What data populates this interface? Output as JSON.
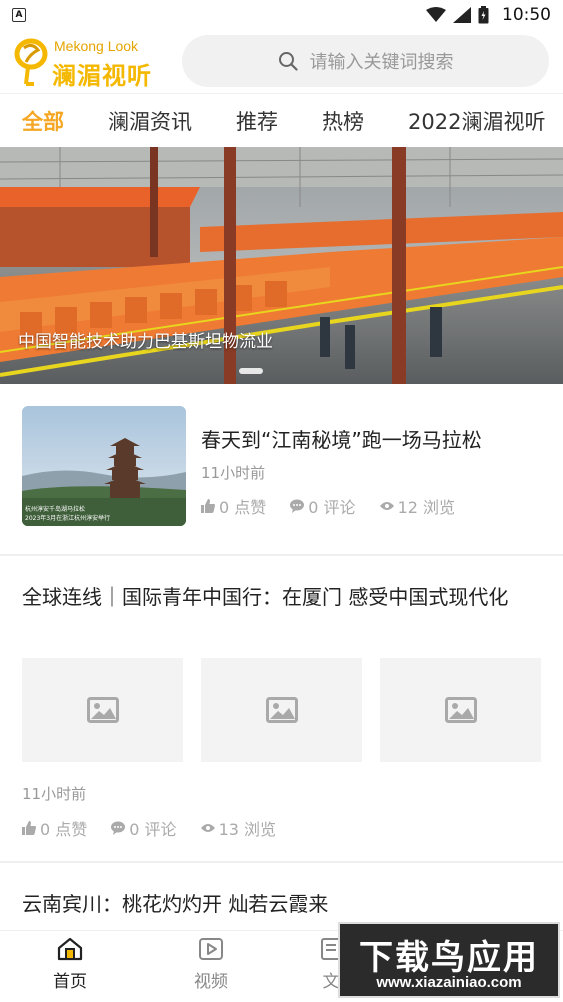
{
  "status_bar": {
    "time": "10:50",
    "left_icon_letter": "A"
  },
  "header": {
    "logo_en": "Mekong Look",
    "logo_cn": "澜湄视听",
    "search_placeholder": "请输入关键词搜索",
    "accent_color": "#f5a623"
  },
  "tabs": [
    {
      "label": "全部",
      "active": true
    },
    {
      "label": "澜湄资讯",
      "active": false
    },
    {
      "label": "推荐",
      "active": false
    },
    {
      "label": "热榜",
      "active": false
    },
    {
      "label": "2022澜湄视听",
      "active": false
    }
  ],
  "banner": {
    "caption": "中国智能技术助力巴基斯坦物流业"
  },
  "news": [
    {
      "title": "春天到“江南秘境”跑一场马拉松",
      "time": "11小时前",
      "likes": "0 点赞",
      "comments": "0 评论",
      "views": "12 浏览",
      "thumb_caption_1": "杭州淳安千岛湖马拉松",
      "thumb_caption_2": "2023年3月在浙江杭州淳安举行"
    },
    {
      "title": "全球连线｜国际青年中国行：在厦门 感受中国式现代化",
      "time": "11小时前",
      "likes": "0 点赞",
      "comments": "0 评论",
      "views": "13 浏览"
    },
    {
      "title": "云南宾川：桃花灼灼开 灿若云霞来"
    }
  ],
  "bottom_nav": [
    {
      "label": "首页",
      "icon": "home-icon",
      "active": true
    },
    {
      "label": "视频",
      "icon": "video-icon",
      "active": false
    },
    {
      "label": "文",
      "icon": "article-icon",
      "active": false
    }
  ],
  "watermark": {
    "big": "下载鸟应用",
    "small": "www.xiazainiao.com"
  }
}
